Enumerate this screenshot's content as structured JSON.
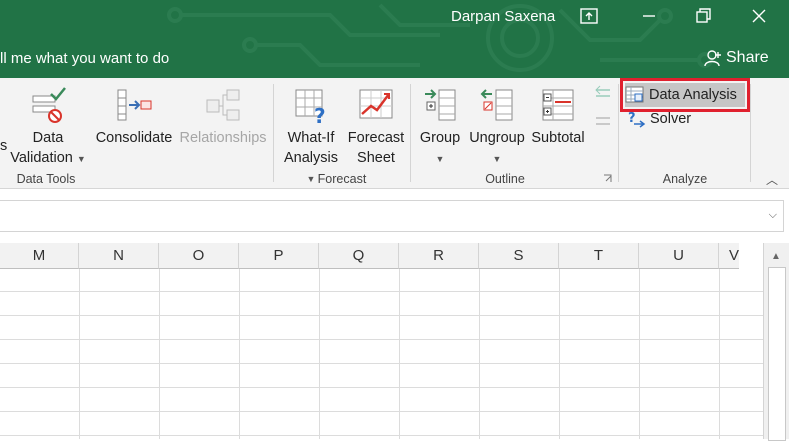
{
  "titlebar": {
    "user_name": "Darpan Saxena",
    "tell_me": "ll me what you want to do",
    "share_label": "Share",
    "bg_color": "#217346"
  },
  "ribbon": {
    "data_tools": {
      "label": "Data Tools",
      "partial_label": "s",
      "data_validation_line1": "Data",
      "data_validation_line2": "Validation",
      "consolidate": "Consolidate",
      "relationships": "Relationships"
    },
    "forecast": {
      "label": "Forecast",
      "what_if_line1": "What-If",
      "what_if_line2": "Analysis",
      "forecast_sheet_line1": "Forecast",
      "forecast_sheet_line2": "Sheet"
    },
    "outline": {
      "label": "Outline",
      "group": "Group",
      "ungroup": "Ungroup",
      "subtotal": "Subtotal"
    },
    "analyze": {
      "label": "Analyze",
      "data_analysis": "Data Analysis",
      "solver": "Solver",
      "highlight_color": "#e0202e"
    }
  },
  "sheet": {
    "columns": [
      "M",
      "N",
      "O",
      "P",
      "Q",
      "R",
      "S",
      "T",
      "U",
      "V"
    ]
  }
}
